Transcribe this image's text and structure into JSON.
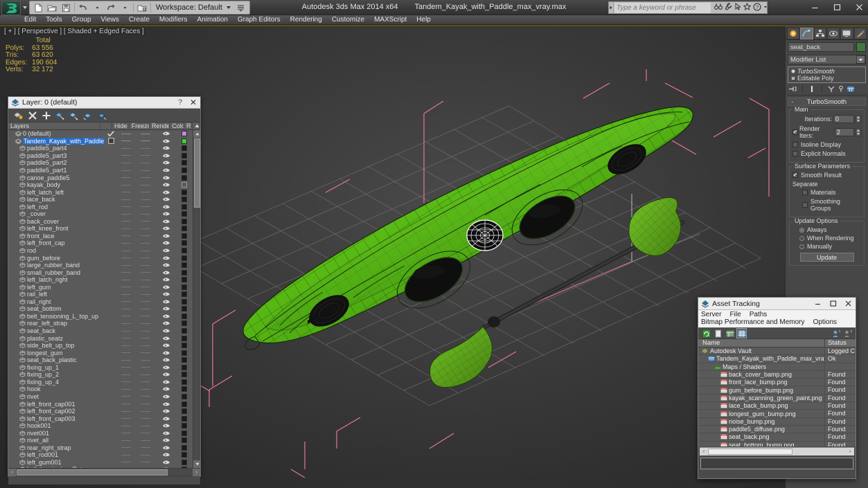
{
  "titlebar": {
    "workspace": "Workspace: Default",
    "app_title": "Autodesk 3ds Max  2014 x64",
    "file_name": "Tandem_Kayak_with_Paddle_max_vray.max",
    "search_placeholder": "Type a keyword or phrase",
    "quick_access": [
      "new-icon",
      "open-icon",
      "save-icon",
      "undo-icon",
      "redo-icon",
      "set-project-icon"
    ],
    "search_icons": [
      "binoculars-icon",
      "wrench-icon",
      "arrow-cursor-icon",
      "star-icon",
      "help-icon"
    ],
    "window_buttons": [
      "minimize-icon",
      "maximize-icon",
      "close-icon"
    ]
  },
  "menubar": {
    "items": [
      "Edit",
      "Tools",
      "Group",
      "Views",
      "Create",
      "Modifiers",
      "Animation",
      "Graph Editors",
      "Rendering",
      "Customize",
      "MAXScript",
      "Help"
    ]
  },
  "viewport": {
    "label": "[ + ] [ Perspective ] [ Shaded + Edged Faces ]",
    "stats": {
      "header": "Total",
      "rows": [
        {
          "key": "Polys:",
          "value": "63 556"
        },
        {
          "key": "Tris:",
          "value": "63 620"
        },
        {
          "key": "Edges:",
          "value": "190 604"
        },
        {
          "key": "Verts:",
          "value": "32 172"
        }
      ]
    },
    "model_colors": {
      "hull_green": "#5fc01a",
      "hull_green_dark": "#3d8a10",
      "wire_black": "#101510",
      "gizmo_pink": "#e06a8c",
      "grid_gray": "#9a9a9a",
      "paddle_shaft": "#202020"
    }
  },
  "layer_dialog": {
    "title": "Layer: 0 (default)",
    "help_label": "?",
    "close_label": "✕",
    "toolbar_buttons": [
      "create-new-layer-icon",
      "delete-layer-icon",
      "add-selection-icon",
      "select-objects-in-layer-icon",
      "select-highlighted-objects-icon",
      "highlight-selected-objects-icon",
      "hide-unselected-icon"
    ],
    "columns": [
      "Layers",
      "",
      "Hide",
      "Freeze",
      "Render",
      "Color",
      "R"
    ],
    "rows": [
      {
        "name": "0 (default)",
        "indent": 1,
        "icon": "layer-icon",
        "check": true,
        "color": "#c585d8",
        "selected": false
      },
      {
        "name": "Tandem_Kayak_with_Paddle",
        "indent": 1,
        "icon": "layer-icon",
        "check": false,
        "box": true,
        "color": "#2fd62f",
        "selected": true
      },
      {
        "name": "paddle5_part4",
        "indent": 2,
        "icon": "object-icon",
        "color": "#1b1b1b"
      },
      {
        "name": "paddle5_part3",
        "indent": 2,
        "icon": "object-icon",
        "color": "#1b1b1b"
      },
      {
        "name": "paddle5_part2",
        "indent": 2,
        "icon": "object-icon",
        "color": "#1b1b1b"
      },
      {
        "name": "paddle5_part1",
        "indent": 2,
        "icon": "object-icon",
        "color": "#1b1b1b"
      },
      {
        "name": "canoe_paddle5",
        "indent": 2,
        "icon": "object-icon",
        "color": "#1b1b1b"
      },
      {
        "name": "kayak_body",
        "indent": 2,
        "icon": "object-icon",
        "color": "#5a5a5a"
      },
      {
        "name": "left_latch_left",
        "indent": 2,
        "icon": "object-icon",
        "color": "#1b1b1b"
      },
      {
        "name": "lace_back",
        "indent": 2,
        "icon": "object-icon",
        "color": "#1b1b1b"
      },
      {
        "name": "left_rod",
        "indent": 2,
        "icon": "object-icon",
        "color": "#1b1b1b"
      },
      {
        "name": "_cover",
        "indent": 2,
        "icon": "object-icon",
        "color": "#1b1b1b"
      },
      {
        "name": "back_cover",
        "indent": 2,
        "icon": "object-icon",
        "color": "#1b1b1b"
      },
      {
        "name": "left_knee_front",
        "indent": 2,
        "icon": "object-icon",
        "color": "#1b1b1b"
      },
      {
        "name": "front_lace",
        "indent": 2,
        "icon": "object-icon",
        "color": "#1b1b1b"
      },
      {
        "name": "left_front_cap",
        "indent": 2,
        "icon": "object-icon",
        "color": "#1b1b1b"
      },
      {
        "name": "rod",
        "indent": 2,
        "icon": "object-icon",
        "color": "#1b1b1b"
      },
      {
        "name": "gum_before",
        "indent": 2,
        "icon": "object-icon",
        "color": "#1b1b1b"
      },
      {
        "name": "large_rubber_band",
        "indent": 2,
        "icon": "object-icon",
        "color": "#1b1b1b"
      },
      {
        "name": "small_rubber_band",
        "indent": 2,
        "icon": "object-icon",
        "color": "#1b1b1b"
      },
      {
        "name": "left_latch_right",
        "indent": 2,
        "icon": "object-icon",
        "color": "#1b1b1b"
      },
      {
        "name": "left_gum",
        "indent": 2,
        "icon": "object-icon",
        "color": "#1b1b1b"
      },
      {
        "name": "rail_left",
        "indent": 2,
        "icon": "object-icon",
        "color": "#1b1b1b"
      },
      {
        "name": "rail_right",
        "indent": 2,
        "icon": "object-icon",
        "color": "#1b1b1b"
      },
      {
        "name": "seat_bottom",
        "indent": 2,
        "icon": "object-icon",
        "color": "#1b1b1b"
      },
      {
        "name": "belt_tensioning_L_top_up",
        "indent": 2,
        "icon": "object-icon",
        "color": "#1b1b1b"
      },
      {
        "name": "rear_left_strap",
        "indent": 2,
        "icon": "object-icon",
        "color": "#1b1b1b"
      },
      {
        "name": "seat_back",
        "indent": 2,
        "icon": "object-icon",
        "color": "#1b1b1b"
      },
      {
        "name": "plastic_seatz",
        "indent": 2,
        "icon": "object-icon",
        "color": "#1b1b1b"
      },
      {
        "name": "side_belt_up_top",
        "indent": 2,
        "icon": "object-icon",
        "color": "#1b1b1b"
      },
      {
        "name": "longest_gum",
        "indent": 2,
        "icon": "object-icon",
        "color": "#1b1b1b"
      },
      {
        "name": "seat_back_plastic",
        "indent": 2,
        "icon": "object-icon",
        "color": "#1b1b1b"
      },
      {
        "name": "fixing_up_1",
        "indent": 2,
        "icon": "object-icon",
        "color": "#1b1b1b"
      },
      {
        "name": "fixing_up_2",
        "indent": 2,
        "icon": "object-icon",
        "color": "#1b1b1b"
      },
      {
        "name": "fixing_up_4",
        "indent": 2,
        "icon": "object-icon",
        "color": "#1b1b1b"
      },
      {
        "name": "hook",
        "indent": 2,
        "icon": "object-icon",
        "color": "#1b1b1b"
      },
      {
        "name": "rivet",
        "indent": 2,
        "icon": "object-icon",
        "color": "#1b1b1b"
      },
      {
        "name": "left_front_cap001",
        "indent": 2,
        "icon": "object-icon",
        "color": "#1b1b1b"
      },
      {
        "name": "left_front_cap002",
        "indent": 2,
        "icon": "object-icon",
        "color": "#1b1b1b"
      },
      {
        "name": "left_front_cap003",
        "indent": 2,
        "icon": "object-icon",
        "color": "#1b1b1b"
      },
      {
        "name": "hook001",
        "indent": 2,
        "icon": "object-icon",
        "color": "#1b1b1b"
      },
      {
        "name": "rivet001",
        "indent": 2,
        "icon": "object-icon",
        "color": "#1b1b1b"
      },
      {
        "name": "rivet_all",
        "indent": 2,
        "icon": "object-icon",
        "color": "#1b1b1b"
      },
      {
        "name": "rear_right_strap",
        "indent": 2,
        "icon": "object-icon",
        "color": "#1b1b1b"
      },
      {
        "name": "left_rod001",
        "indent": 2,
        "icon": "object-icon",
        "color": "#1b1b1b"
      },
      {
        "name": "left_gum001",
        "indent": 2,
        "icon": "object-icon",
        "color": "#1b1b1b"
      },
      {
        "name": "belt_tensioning_R_top_up",
        "indent": 2,
        "icon": "object-icon",
        "color": "#1b1b1b"
      }
    ]
  },
  "command_panel": {
    "tabs": [
      "create-tab-icon",
      "modify-tab-icon",
      "hierarchy-tab-icon",
      "motion-tab-icon",
      "display-tab-icon",
      "utilities-tab-icon"
    ],
    "active_tab_index": 1,
    "object_name": "seat_back",
    "object_color": "#3d7c3d",
    "modifier_list_label": "Modifier List",
    "stack": [
      {
        "label": "TurboSmooth",
        "type": "modifier"
      },
      {
        "label": "Editable Poly",
        "type": "base"
      }
    ],
    "stack_buttons": [
      "pin-stack-icon",
      "show-end-result-icon",
      "make-unique-icon",
      "remove-modifier-icon",
      "configure-sets-icon"
    ],
    "rollout": {
      "title": "TurboSmooth",
      "collapse_label": "-",
      "groups": [
        {
          "label": "Main",
          "fields": [
            {
              "type": "spinner",
              "label": "Iterations:",
              "value": "0"
            },
            {
              "type": "spinner_check",
              "label": "Render Iters:",
              "value": "2",
              "checked": true
            },
            {
              "type": "check",
              "label": "Isoline Display",
              "checked": false
            },
            {
              "type": "check",
              "label": "Explicit Normals",
              "checked": false
            }
          ]
        },
        {
          "label": "Surface Parameters",
          "fields": [
            {
              "type": "check",
              "label": "Smooth Result",
              "checked": true
            },
            {
              "type": "text",
              "label": "Separate"
            },
            {
              "type": "check",
              "label": "Materials",
              "checked": false,
              "indent": true
            },
            {
              "type": "check",
              "label": "Smoothing Groups",
              "checked": false,
              "indent": true
            }
          ]
        },
        {
          "label": "Update Options",
          "fields": [
            {
              "type": "radio",
              "label": "Always",
              "checked": true
            },
            {
              "type": "radio",
              "label": "When Rendering",
              "checked": false
            },
            {
              "type": "radio",
              "label": "Manually",
              "checked": false
            },
            {
              "type": "button",
              "label": "Update"
            }
          ]
        }
      ]
    }
  },
  "asset_tracking": {
    "title": "Asset Tracking",
    "window_buttons": [
      "minimize-icon",
      "maximize-icon",
      "close-icon"
    ],
    "menus": [
      "Server",
      "File",
      "Paths",
      "Bitmap Performance and Memory",
      "Options"
    ],
    "toolbar_buttons": [
      "refresh-icon",
      "stop-icon",
      "list-view-icon",
      "grid-view-icon"
    ],
    "right_buttons": [
      "user-icon",
      "help-icon"
    ],
    "columns": [
      "Name",
      "Status"
    ],
    "rows": [
      {
        "name": "Autodesk Vault",
        "status": "Logged C",
        "indent": 0,
        "icon": "vault-icon"
      },
      {
        "name": "Tandem_Kayak_with_Paddle_max_vray.max",
        "status": "Ok",
        "indent": 1,
        "icon": "max-file-icon"
      },
      {
        "name": "Maps / Shaders",
        "status": "",
        "indent": 2,
        "icon": "maps-icon"
      },
      {
        "name": "back_cover_bamp.png",
        "status": "Found",
        "indent": 3,
        "icon": "bitmap-icon"
      },
      {
        "name": "front_lace_bump.png",
        "status": "Found",
        "indent": 3,
        "icon": "bitmap-icon"
      },
      {
        "name": "gum_before_bump.png",
        "status": "Found",
        "indent": 3,
        "icon": "bitmap-icon"
      },
      {
        "name": "kayak_scanning_green_paint.png",
        "status": "Found",
        "indent": 3,
        "icon": "bitmap-icon"
      },
      {
        "name": "lace_back_bump.png",
        "status": "Found",
        "indent": 3,
        "icon": "bitmap-icon"
      },
      {
        "name": "longest_gum_bump.png",
        "status": "Found",
        "indent": 3,
        "icon": "bitmap-icon"
      },
      {
        "name": "noise_bump.png",
        "status": "Found",
        "indent": 3,
        "icon": "bitmap-icon"
      },
      {
        "name": "paddle5_diffuse.png",
        "status": "Found",
        "indent": 3,
        "icon": "bitmap-icon"
      },
      {
        "name": "seat_back.png",
        "status": "Found",
        "indent": 3,
        "icon": "bitmap-icon"
      },
      {
        "name": "seat_bottom_bump.png",
        "status": "Found",
        "indent": 3,
        "icon": "bitmap-icon"
      }
    ]
  }
}
